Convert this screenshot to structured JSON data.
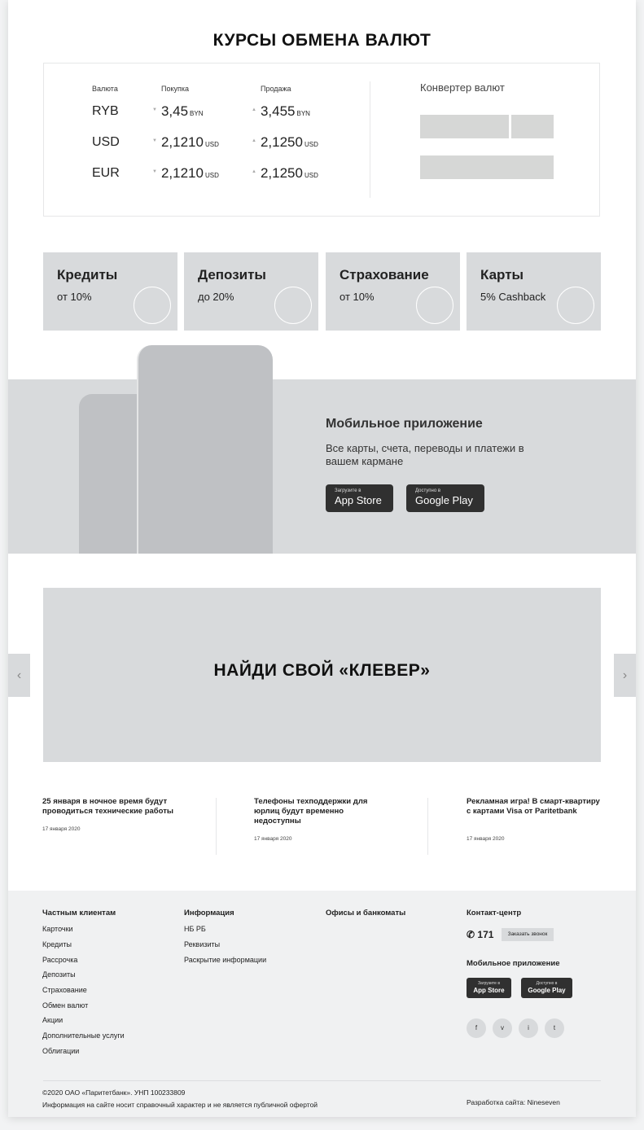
{
  "rates": {
    "title": "КУРСЫ ОБМЕНА ВАЛЮТ",
    "headers": {
      "currency": "Валюта",
      "buy": "Покупка",
      "sell": "Продажа"
    },
    "rows": [
      {
        "currency": "RYB",
        "buy": "3,45",
        "buy_unit": "BYN",
        "sell": "3,455",
        "sell_unit": "BYN"
      },
      {
        "currency": "USD",
        "buy": "2,1210",
        "buy_unit": "USD",
        "sell": "2,1250",
        "sell_unit": "USD"
      },
      {
        "currency": "EUR",
        "buy": "2,1210",
        "buy_unit": "USD",
        "sell": "2,1250",
        "sell_unit": "USD"
      }
    ],
    "converter_title": "Конвертер валют"
  },
  "products": [
    {
      "title": "Кредиты",
      "subtitle": "от 10%"
    },
    {
      "title": "Депозиты",
      "subtitle": "до 20%"
    },
    {
      "title": "Страхование",
      "subtitle": "от 10%"
    },
    {
      "title": "Карты",
      "subtitle": "5% Cashback"
    }
  ],
  "mobile": {
    "title": "Мобильное приложение",
    "text": "Все карты, счета, переводы и платежи в вашем кармане",
    "appstore_small": "Загрузите в",
    "appstore_big": "App Store",
    "gplay_small": "Доступно в",
    "gplay_big": "Google Play"
  },
  "banner": {
    "text": "НАЙДИ СВОЙ «КЛЕВЕР»",
    "prev_icon": "‹",
    "next_icon": "›"
  },
  "news": [
    {
      "title": "25 января в ночное время будут проводиться технические работы",
      "date": "17 января 2020"
    },
    {
      "title": "Телефоны техподдержки для юрлиц будут временно недоступны",
      "date": "17 января 2020"
    },
    {
      "title": "Рекламная игра! В смарт-квартиру с картами Visa от Paritetbank",
      "date": "17 января 2020"
    }
  ],
  "footer": {
    "col1": {
      "title": "Частным клиентам",
      "links": [
        "Карточки",
        "Кредиты",
        "Рассрочка",
        "Депозиты",
        "Страхование",
        "Обмен валют",
        "Акции",
        "Дополнительные услуги",
        "Облигации"
      ]
    },
    "col2": {
      "title": "Информация",
      "links": [
        "НБ РБ",
        "Реквизиты",
        "Раскрытие информации"
      ]
    },
    "col3": {
      "title": "Офисы и банкоматы"
    },
    "contact": {
      "title": "Контакт-центр",
      "phone_icon": "✆",
      "phone": "171",
      "call_button": "Заказать звонок",
      "mobile_title": "Мобильное приложение",
      "appstore_small": "Загрузите в",
      "appstore_big": "App Store",
      "gplay_small": "Доступно в",
      "gplay_big": "Google Play",
      "social": [
        "f",
        "v",
        "i",
        "t"
      ]
    },
    "copyright": "©2020 ОАО «Паритетбанк». УНП 100233809",
    "disclaimer": "Информация на сайте носит справочный характер и не является публичной офертой",
    "developer": "Разработка сайта: Nineseven"
  }
}
